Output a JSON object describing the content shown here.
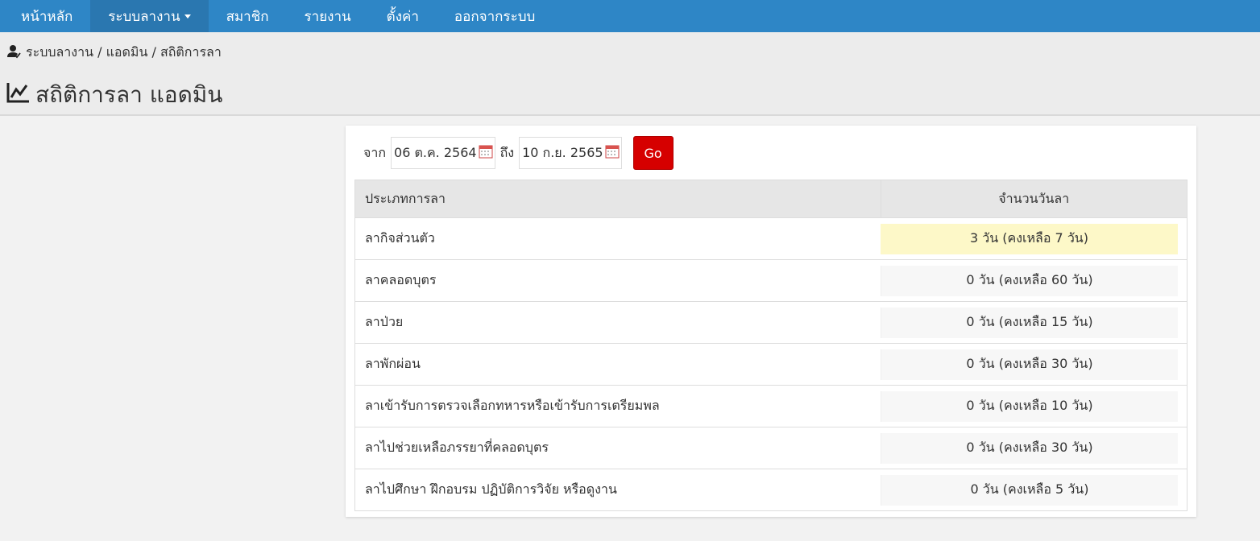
{
  "nav": {
    "items": [
      {
        "label": "หน้าหลัก"
      },
      {
        "label": "ระบบลางาน"
      },
      {
        "label": "สมาชิก"
      },
      {
        "label": "รายงาน"
      },
      {
        "label": "ตั้งค่า"
      },
      {
        "label": "ออกจากระบบ"
      }
    ]
  },
  "breadcrumb": {
    "text": "ระบบลางาน / แอดมิน / สถิติการลา"
  },
  "page": {
    "title": "สถิติการลา แอดมิน"
  },
  "filter": {
    "from_label": "จาก",
    "from_value": "06 ต.ค. 2564",
    "to_label": "ถึง",
    "to_value": "10 ก.ย. 2565",
    "go_label": "Go"
  },
  "table": {
    "headers": [
      "ประเภทการลา",
      "จำนวนวันลา"
    ],
    "rows": [
      {
        "type": "ลากิจส่วนตัว",
        "days": "3 วัน (คงเหลือ 7 วัน)"
      },
      {
        "type": "ลาคลอดบุตร",
        "days": "0 วัน (คงเหลือ 60 วัน)"
      },
      {
        "type": "ลาป่วย",
        "days": "0 วัน (คงเหลือ 15 วัน)"
      },
      {
        "type": "ลาพักผ่อน",
        "days": "0 วัน (คงเหลือ 30 วัน)"
      },
      {
        "type": "ลาเข้ารับการตรวจเลือกทหารหรือเข้ารับการเตรียมพล",
        "days": "0 วัน (คงเหลือ 10 วัน)"
      },
      {
        "type": "ลาไปช่วยเหลือภรรยาที่คลอดบุตร",
        "days": "0 วัน (คงเหลือ 30 วัน)"
      },
      {
        "type": "ลาไปศึกษา ฝึกอบรม ปฏิบัติการวิจัย หรือดูงาน",
        "days": "0 วัน (คงเหลือ 5 วัน)"
      }
    ]
  },
  "colors": {
    "navbar": "#2e86c6",
    "go_button": "#d60000",
    "highlight": "#fdf8c8"
  },
  "icons": {
    "breadcrumb": "user-icon",
    "title": "line-chart-icon",
    "date": "calendar-icon"
  }
}
